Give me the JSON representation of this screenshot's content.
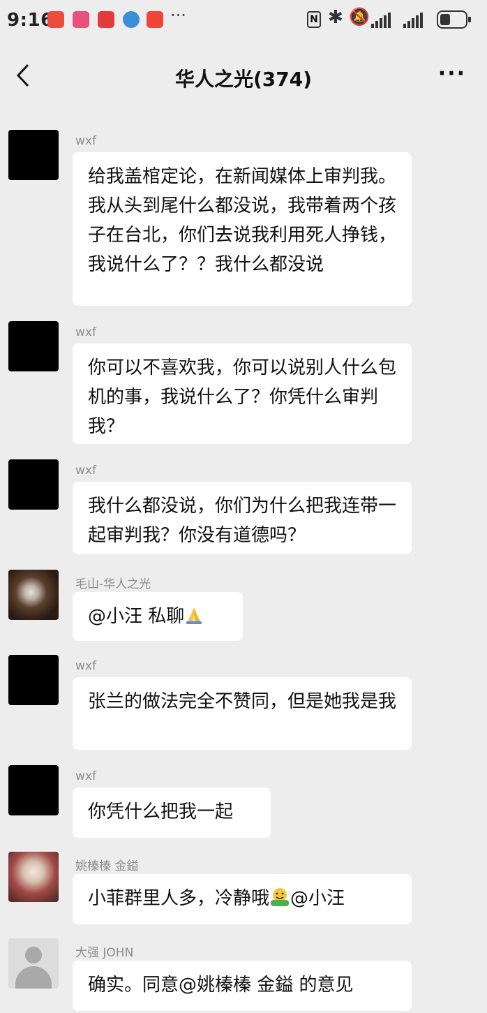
{
  "status_bar": {
    "time": "9:16",
    "more": "···",
    "nfc": "N",
    "bluetooth": "✱",
    "mute": "🔕",
    "battery_level": 0.42
  },
  "nav": {
    "title": "华人之光(374)",
    "more": "···"
  },
  "messages": [
    {
      "sender": "wxf",
      "avatar": "black-avatar",
      "text": "给我盖棺定论，在新闻媒体上审判我。我从头到尾什么都没说，我带着两个孩子在台北，你们去说我利用死人挣钱，我说什么了？？我什么都没说"
    },
    {
      "sender": "wxf",
      "avatar": "black-avatar",
      "text": "你可以不喜欢我，你可以说别人什么包机的事，我说什么了？你凭什么审判我？"
    },
    {
      "sender": "wxf",
      "avatar": "black-avatar",
      "text": "我什么都没说，你们为什么把我连带一起审判我？你没有道德吗？"
    },
    {
      "sender": "毛山-华人之光",
      "avatar": "photo-avatar",
      "text": "@小汪  私聊",
      "emoji": "folded-hands-emoji"
    },
    {
      "sender": "wxf",
      "avatar": "black-avatar",
      "text": "张兰的做法完全不赞同，但是她我是我"
    },
    {
      "sender": "wxf",
      "avatar": "black-avatar",
      "text": "你凭什么把我一起"
    },
    {
      "sender": "姚榛榛 金鎰",
      "avatar": "photo-avatar",
      "text_before": "小菲群里人多，冷静哦",
      "emoji": "hugging-face-emoji",
      "text_after": "@小汪"
    },
    {
      "sender": "大强 JOHN",
      "avatar": "default-avatar",
      "text": "确实。同意@姚榛榛 金鎰 的意见"
    }
  ]
}
